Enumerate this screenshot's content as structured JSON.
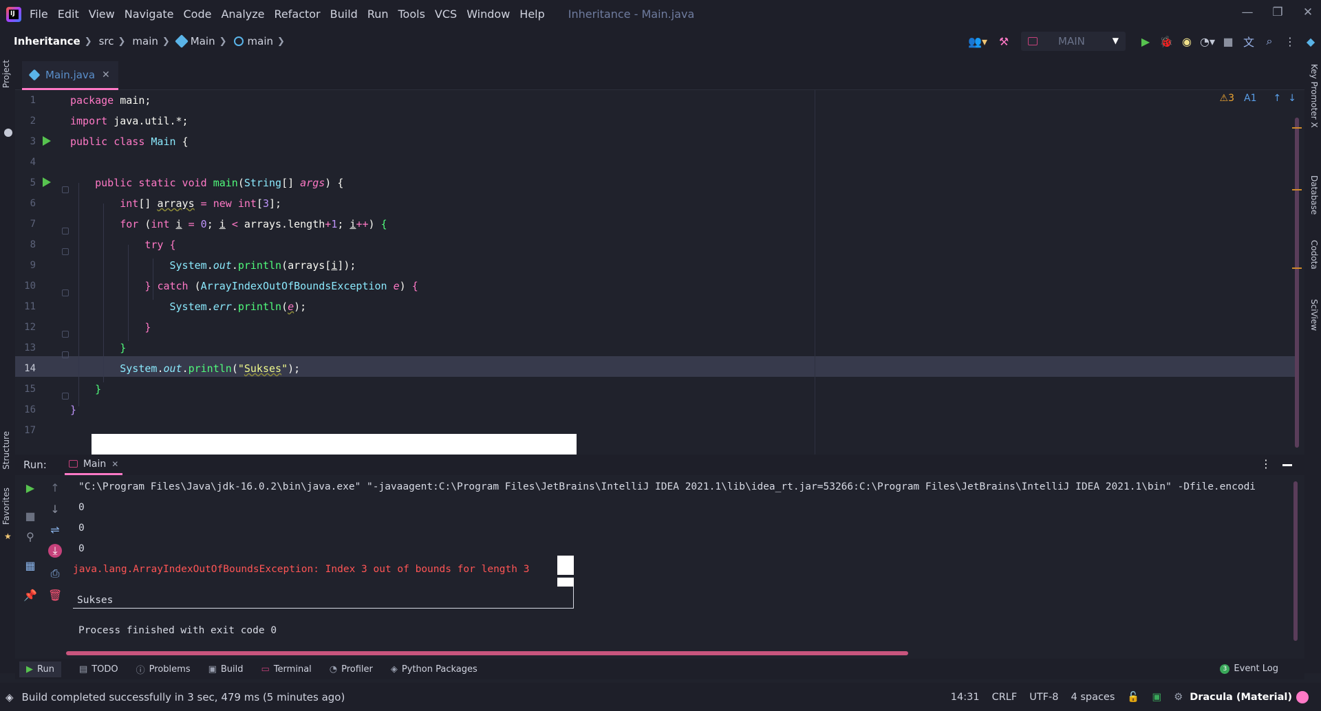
{
  "menubar": {
    "items": [
      "File",
      "Edit",
      "View",
      "Navigate",
      "Code",
      "Analyze",
      "Refactor",
      "Build",
      "Run",
      "Tools",
      "VCS",
      "Window",
      "Help"
    ],
    "window_title": "Inheritance - Main.java"
  },
  "navbar": {
    "crumbs": [
      "Inheritance",
      "src",
      "main",
      "Main",
      "main"
    ],
    "run_config": "MAIN"
  },
  "left_strip": {
    "project": "Project",
    "structure": "Structure",
    "favorites": "Favorites"
  },
  "right_strip": {
    "key_promoter": "Key Promoter X",
    "database": "Database",
    "codota": "Codota",
    "sciview": "SciView"
  },
  "editor": {
    "tab_label": "Main.java",
    "warnings": "3",
    "typos": "1",
    "current_line": 14,
    "line_numbers": [
      "1",
      "2",
      "3",
      "4",
      "5",
      "6",
      "7",
      "8",
      "9",
      "10",
      "11",
      "12",
      "13",
      "14",
      "15",
      "16",
      "17"
    ]
  },
  "run_panel": {
    "title": "Run:",
    "tab_label": "Main",
    "console": {
      "cmd": "\"C:\\Program Files\\Java\\jdk-16.0.2\\bin\\java.exe\" \"-javaagent:C:\\Program Files\\JetBrains\\IntelliJ IDEA 2021.1\\lib\\idea_rt.jar=53266:C:\\Program Files\\JetBrains\\IntelliJ IDEA 2021.1\\bin\" -Dfile.encodi",
      "out1": "0",
      "out2": "0",
      "out3": "0",
      "err": "java.lang.ArrayIndexOutOfBoundsException: Index 3 out of bounds for length 3",
      "sukses": "Sukses",
      "finished": "Process finished with exit code 0"
    }
  },
  "bottom_tabs": [
    "Run",
    "TODO",
    "Problems",
    "Build",
    "Terminal",
    "Profiler",
    "Python Packages"
  ],
  "event_log": {
    "count": "3",
    "label": "Event Log"
  },
  "status": {
    "message": "Build completed successfully in 3 sec, 479 ms (5 minutes ago)",
    "position": "14:31",
    "line_sep": "CRLF",
    "encoding": "UTF-8",
    "indent": "4 spaces",
    "theme": "Dracula (Material)"
  },
  "colors": {
    "accent": "#ff79c6",
    "run_green": "#57c34f",
    "error_red": "#ff5555",
    "background": "#20222c"
  }
}
